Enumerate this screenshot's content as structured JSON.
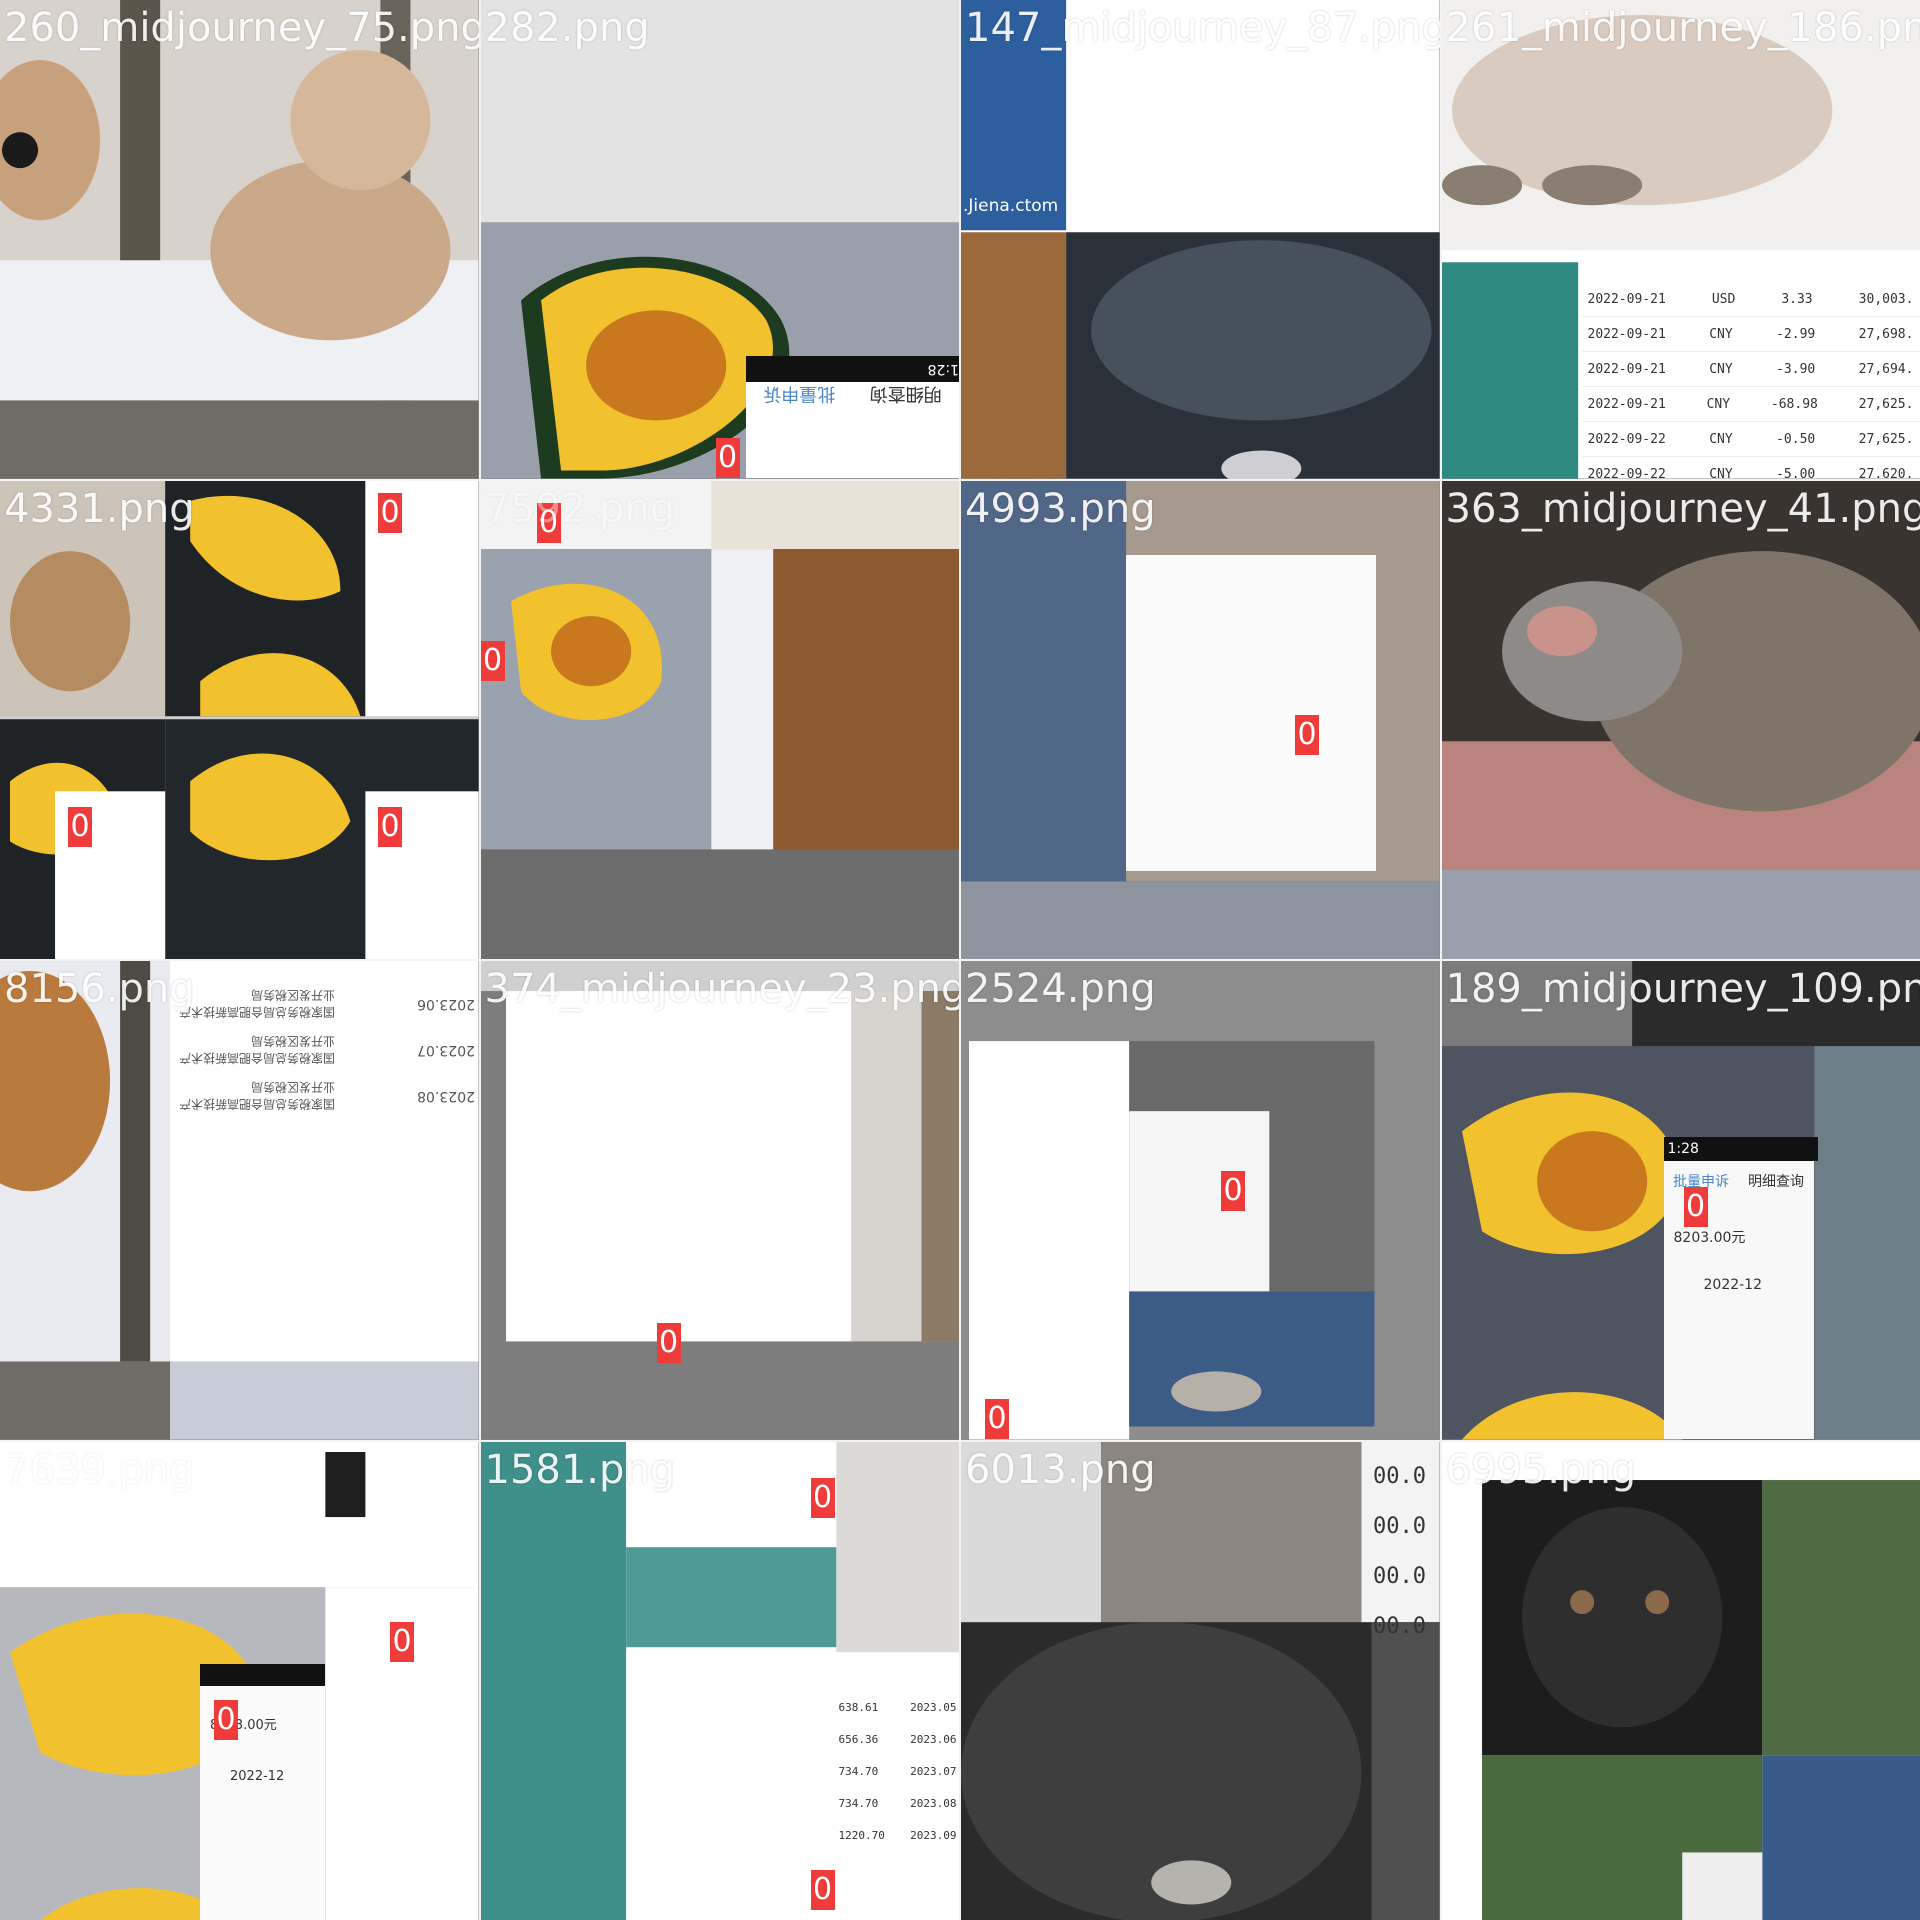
{
  "tiles": [
    {
      "label": "260_midjourney_75.png"
    },
    {
      "label": "282.png"
    },
    {
      "label": "147_midjourney_87.png"
    },
    {
      "label": "261_midjourney_186.png"
    },
    {
      "label": "4331.png"
    },
    {
      "label": "7592.png"
    },
    {
      "label": "4993.png"
    },
    {
      "label": "363_midjourney_41.png"
    },
    {
      "label": "8156.png"
    },
    {
      "label": "374_midjourney_23.png"
    },
    {
      "label": "2524.png"
    },
    {
      "label": "189_midjourney_109.png"
    },
    {
      "label": "7639.png"
    },
    {
      "label": "1581.png"
    },
    {
      "label": "6013.png"
    },
    {
      "label": "6995.png"
    }
  ],
  "badge_text": "0",
  "phone_ui": {
    "time": "1:28",
    "tab_active": "批量申诉",
    "tab_other": "明细查询",
    "amount": "8203.00元",
    "month": "2022-12"
  },
  "watermark": ".Jiena.ctom",
  "ledger_rows": [
    {
      "date": "2022-09-21",
      "cur": "USD",
      "amt": "3.33",
      "bal": "30,003."
    },
    {
      "date": "2022-09-21",
      "cur": "CNY",
      "amt": "-2.99",
      "bal": "27,698."
    },
    {
      "date": "2022-09-21",
      "cur": "CNY",
      "amt": "-3.90",
      "bal": "27,694."
    },
    {
      "date": "2022-09-21",
      "cur": "CNY",
      "amt": "-68.98",
      "bal": "27,625."
    },
    {
      "date": "2022-09-22",
      "cur": "CNY",
      "amt": "-0.50",
      "bal": "27,625."
    },
    {
      "date": "2022-09-22",
      "cur": "CNY",
      "amt": "-5.00",
      "bal": "27,620."
    }
  ],
  "tax_rows": [
    {
      "date": "2023.06",
      "text": "国家税务总局合肥高新技术产业开发区税务局"
    },
    {
      "date": "2023.07",
      "text": "国家税务总局合肥高新技术产业开发区税务局"
    },
    {
      "date": "2023.08",
      "text": "国家税务总局合肥高新技术产业开发区税务局"
    }
  ],
  "income_rows": [
    {
      "amt": "638.61",
      "period": "2023.05"
    },
    {
      "amt": "656.36",
      "period": "2023.06"
    },
    {
      "amt": "734.70",
      "period": "2023.07"
    },
    {
      "amt": "734.70",
      "period": "2023.08"
    },
    {
      "amt": "1220.70",
      "period": "2023.09"
    }
  ],
  "zero_rows": [
    "00.0",
    "00.0",
    "00.0",
    "00.0"
  ],
  "colors": {
    "badge": "#f03b3b",
    "teal": "#2f8a82",
    "yellow": "#f2c12e",
    "water": "#2d5e9e"
  }
}
